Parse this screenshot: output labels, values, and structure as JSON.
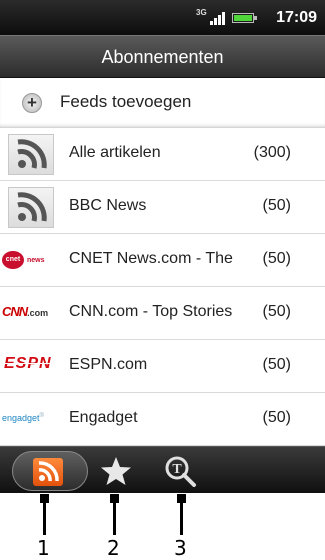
{
  "status_bar": {
    "network": "3G",
    "time": "17:09"
  },
  "header": {
    "title": "Abonnementen"
  },
  "add_feed": {
    "label": "Feeds toevoegen"
  },
  "feeds": [
    {
      "name": "Alle artikelen",
      "count": "(300)",
      "icon": "rss-icon"
    },
    {
      "name": "BBC News",
      "count": "(50)",
      "icon": "rss-icon"
    },
    {
      "name": "CNET News.com - The",
      "count": "(50)",
      "icon": "cnet-logo",
      "logo_text": "cnet",
      "logo_word": "news"
    },
    {
      "name": "CNN.com - Top Stories",
      "count": "(50)",
      "icon": "cnn-logo",
      "logo_text": "CNN",
      "logo_suffix": ".com"
    },
    {
      "name": "ESPN.com",
      "count": "(50)",
      "icon": "espn-logo",
      "logo_text": "ESPN"
    },
    {
      "name": "Engadget",
      "count": "(50)",
      "icon": "engadget-logo",
      "logo_text": "engadget"
    }
  ],
  "tabs": [
    {
      "name": "subscriptions-tab",
      "icon": "rss-icon",
      "active": true
    },
    {
      "name": "starred-tab",
      "icon": "star-icon",
      "active": false
    },
    {
      "name": "search-tab",
      "icon": "search-icon",
      "active": false
    }
  ],
  "callouts": [
    "1",
    "2",
    "3"
  ],
  "colors": {
    "rss_orange": "#f26d21",
    "header_gray": "#404040",
    "cnn_red": "#cc0000",
    "espn_red": "#d20a11"
  }
}
